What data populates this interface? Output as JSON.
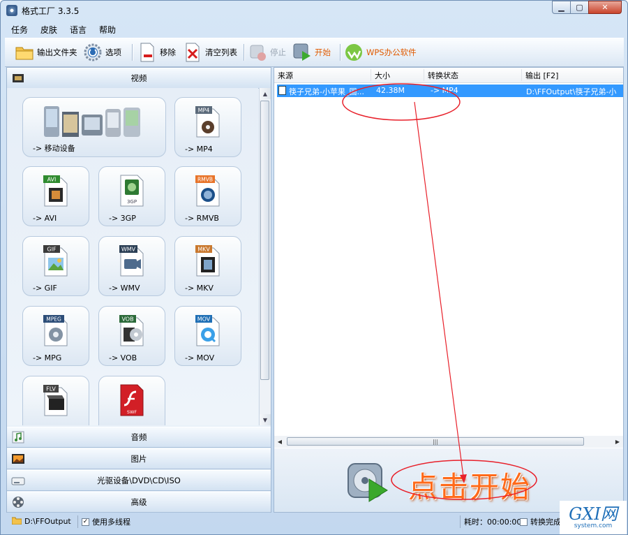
{
  "window": {
    "title": "格式工厂 3.3.5"
  },
  "menu": [
    "任务",
    "皮肤",
    "语言",
    "帮助"
  ],
  "toolbar": {
    "output_folder": "输出文件夹",
    "options": "选项",
    "remove": "移除",
    "clear_list": "清空列表",
    "stop": "停止",
    "start": "开始",
    "wps": "WPS办公软件"
  },
  "categories": {
    "video": "视频",
    "audio": "音频",
    "picture": "图片",
    "rom": "光驱设备\\DVD\\CD\\ISO",
    "advanced": "高级"
  },
  "tiles": [
    {
      "label": "-> 移动设备",
      "badge": ""
    },
    {
      "label": "-> MP4",
      "badge": "MP4"
    },
    {
      "label": "-> AVI",
      "badge": "AVI"
    },
    {
      "label": "-> 3GP",
      "badge": "3GP"
    },
    {
      "label": "-> RMVB",
      "badge": "RMVB"
    },
    {
      "label": "-> GIF",
      "badge": "GIF"
    },
    {
      "label": "-> WMV",
      "badge": "WMV"
    },
    {
      "label": "-> MKV",
      "badge": "MKV"
    },
    {
      "label": "-> MPG",
      "badge": "MPEG"
    },
    {
      "label": "-> VOB",
      "badge": "VOB"
    },
    {
      "label": "-> MOV",
      "badge": "MOV"
    },
    {
      "label": "",
      "badge": "FLV"
    },
    {
      "label": "",
      "badge": "SWF"
    }
  ],
  "table": {
    "headers": {
      "source": "来源",
      "size": "大小",
      "status": "转换状态",
      "output": "输出 [F2]"
    },
    "rows": [
      {
        "source": "筷子兄弟-小苹果_国...",
        "size": "42.38M",
        "status": "-> MP4",
        "output": "D:\\FFOutput\\筷子兄弟-小"
      }
    ]
  },
  "annotation": {
    "start_hint": "点击开始"
  },
  "status": {
    "folder": "D:\\FFOutput",
    "multithread": "使用多线程",
    "elapsed": "耗时：00:00:00",
    "after_convert": "转换完成"
  },
  "watermark": {
    "line1": "GXI网",
    "line2": "system.com"
  },
  "colors": {
    "selection": "#3399ff",
    "annotation": "#e8202a",
    "start_text": "#ff6a1a"
  }
}
